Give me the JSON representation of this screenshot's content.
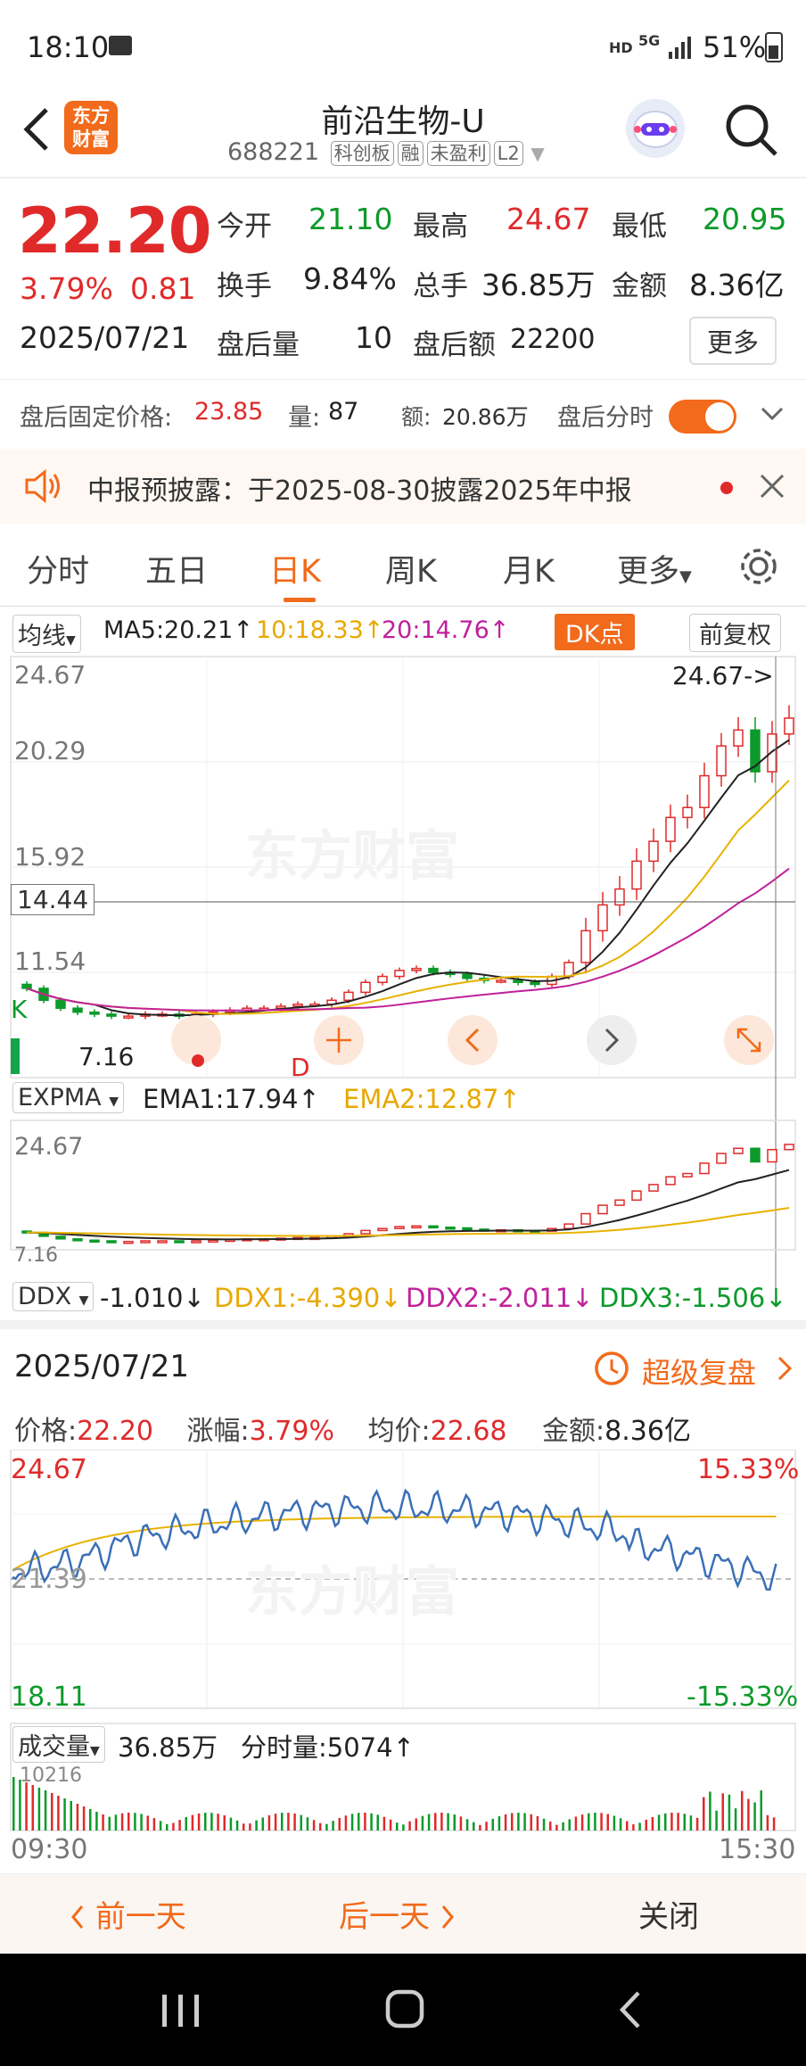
{
  "status_bar": {
    "time": "18:10",
    "net": "HD",
    "net2": "5G",
    "battery": "51%"
  },
  "header": {
    "app_logo_line1": "东方",
    "app_logo_line2": "财富",
    "title": "前沿生物-U",
    "code": "688221",
    "tags": [
      "科创板",
      "融",
      "未盈利",
      "L2"
    ]
  },
  "quote": {
    "price": "22.20",
    "change_pct": "3.79%",
    "change_amt": "0.81",
    "date": "2025/07/21",
    "open_label": "今开",
    "open": "21.10",
    "high_label": "最高",
    "high": "24.67",
    "low_label": "最低",
    "low": "20.95",
    "turnover_label": "换手",
    "turnover": "9.84%",
    "volume_label": "总手",
    "volume": "36.85万",
    "amount_label": "金额",
    "amount": "8.36亿",
    "after_vol_label": "盘后量",
    "after_vol": "10",
    "after_amt_label": "盘后额",
    "after_amt": "22200",
    "more": "更多"
  },
  "after_hours": {
    "price_label": "盘后固定价格:",
    "price": "23.85",
    "qty_label": "量:",
    "qty": "87",
    "amt_label": "额:",
    "amt": "20.86万",
    "toggle_label": "盘后分时"
  },
  "notice": {
    "text": "中报预披露：于2025-08-30披露2025年中报"
  },
  "tabs": [
    "分时",
    "五日",
    "日K",
    "周K",
    "月K",
    "更多"
  ],
  "active_tab": "日K",
  "kline": {
    "ma_selector": "均线",
    "ma5": "MA5:20.21↑",
    "ma10": "10:18.33↑",
    "ma20": "20:14.76↑",
    "dk_button": "DK点",
    "adjust_button": "前复权",
    "y_labels": [
      "24.67",
      "20.29",
      "15.92",
      "11.54"
    ],
    "crosshair_value": "14.44",
    "max_marker": "24.67->",
    "min_marker": "7.16",
    "marker_k": "K",
    "marker_d": "D",
    "expma_selector": "EXPMA",
    "ema1": "EMA1:17.94↑",
    "ema2": "EMA2:12.87↑",
    "expma_top": "24.67",
    "expma_bottom": "7.16",
    "ddx_selector": "DDX",
    "ddx": "-1.010↓",
    "ddx1": "DDX1:-4.390↓",
    "ddx2": "DDX2:-2.011↓",
    "ddx3": "DDX3:-1.506↓"
  },
  "chart_data": {
    "type": "candlestick",
    "title": "",
    "y_range": [
      7.16,
      24.67
    ],
    "closes_approx": [
      8.6,
      8.0,
      7.6,
      7.4,
      7.3,
      7.2,
      7.2,
      7.3,
      7.3,
      7.2,
      7.3,
      7.4,
      7.5,
      7.6,
      7.6,
      7.7,
      7.8,
      7.8,
      8.0,
      8.4,
      8.9,
      9.2,
      9.5,
      9.6,
      9.4,
      9.3,
      9.1,
      9.0,
      9.0,
      8.9,
      8.8,
      9.2,
      9.9,
      11.5,
      12.8,
      13.6,
      15.0,
      16.0,
      17.2,
      17.7,
      19.3,
      20.8,
      21.6,
      19.5,
      21.4,
      22.2
    ]
  },
  "intraday": {
    "date": "2025/07/21",
    "review_link": "超级复盘",
    "price_label": "价格:",
    "price": "22.20",
    "chg_label": "涨幅:",
    "chg": "3.79%",
    "avg_label": "均价:",
    "avg": "22.68",
    "amt_label": "金额:",
    "amt": "8.36亿",
    "y_top": "24.67",
    "y_mid": "21.39",
    "y_bottom": "18.11",
    "pct_top": "15.33%",
    "pct_bottom": "-15.33%",
    "vol_selector": "成交量",
    "vol": "36.85万",
    "tick_vol": "分时量:5074↑",
    "vol_max": "10216",
    "time_start": "09:30",
    "time_end": "15:30"
  },
  "bottom": {
    "prev": "前一天",
    "next": "后一天",
    "close": "关闭"
  }
}
